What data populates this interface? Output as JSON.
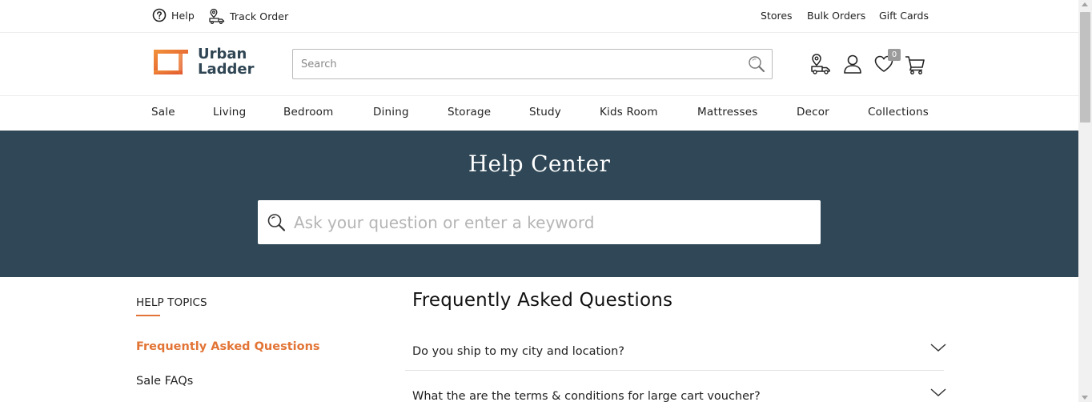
{
  "topbar": {
    "help_label": "Help",
    "track_order_label": "Track Order",
    "stores_label": "Stores",
    "bulk_orders_label": "Bulk Orders",
    "gift_cards_label": "Gift Cards"
  },
  "header": {
    "logo_line1": "Urban",
    "logo_line2": "Ladder",
    "search_placeholder": "Search",
    "wishlist_count": "0",
    "icons": [
      "store-locator-icon",
      "user-icon",
      "wishlist-heart-icon",
      "cart-icon"
    ]
  },
  "nav": {
    "items": [
      "Sale",
      "Living",
      "Bedroom",
      "Dining",
      "Storage",
      "Study",
      "Kids Room",
      "Mattresses",
      "Decor",
      "Collections"
    ]
  },
  "hero": {
    "title": "Help Center",
    "search_placeholder": "Ask your question or enter a keyword"
  },
  "sidebar": {
    "heading": "HELP TOPICS",
    "items": [
      "Frequently Asked Questions",
      "Sale FAQs"
    ],
    "active_index": 0
  },
  "faq": {
    "title": "Frequently Asked Questions",
    "questions": [
      "Do you ship to my city and location?",
      "What the are the terms & conditions for large cart voucher?"
    ]
  },
  "colors": {
    "accent": "#e27435",
    "hero_bg": "#2f4756",
    "logo_text": "#2f4553"
  }
}
